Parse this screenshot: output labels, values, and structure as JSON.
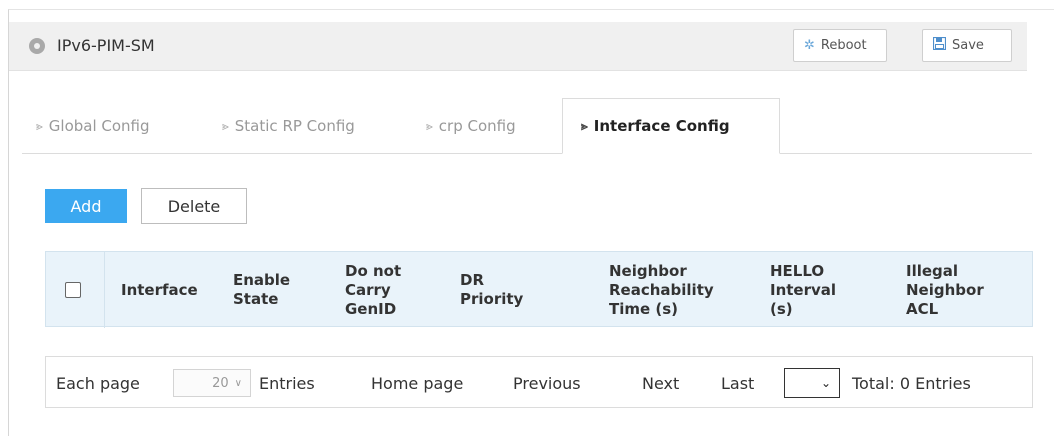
{
  "header": {
    "title": "IPv6-PIM-SM",
    "title_icon": "location-pin-icon",
    "reboot_label": "Reboot",
    "save_label": "Save"
  },
  "tabs": [
    {
      "label": "Global Config",
      "active": false
    },
    {
      "label": "Static RP Config",
      "active": false
    },
    {
      "label": "crp Config",
      "active": false
    },
    {
      "label": "Interface Config",
      "active": true
    }
  ],
  "toolbar": {
    "add_label": "Add",
    "delete_label": "Delete"
  },
  "table": {
    "columns": [
      [
        "Interface"
      ],
      [
        "Enable",
        "State"
      ],
      [
        "Do not",
        "Carry",
        "GenID"
      ],
      [
        "DR",
        "Priority"
      ],
      [
        "Neighbor",
        "Reachability",
        "Time (s)"
      ],
      [
        "HELLO",
        "Interval",
        "(s)"
      ],
      [
        "Illegal",
        "Neighbor",
        "ACL"
      ]
    ],
    "rows": []
  },
  "pager": {
    "each_page_label": "Each page",
    "page_size": "20",
    "entries_label": "Entries",
    "home_label": "Home page",
    "previous_label": "Previous",
    "next_label": "Next",
    "last_label": "Last",
    "last_select_value": "",
    "total_label": "Total: 0 Entries"
  },
  "colors": {
    "accent": "#3ba8f0",
    "table_header_bg": "#e9f3fa"
  }
}
